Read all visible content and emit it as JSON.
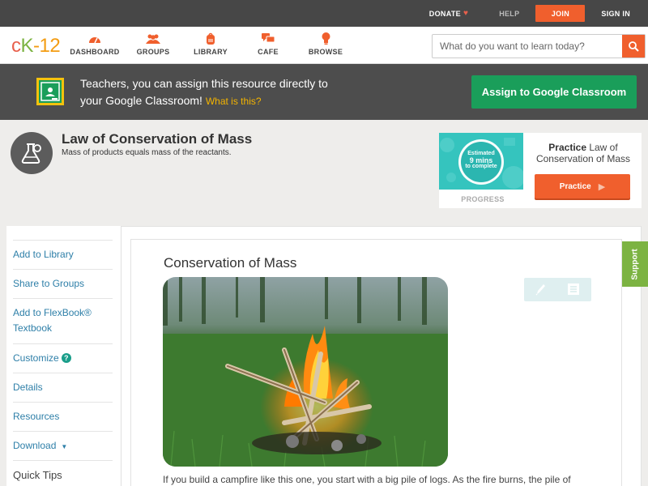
{
  "topbar": {
    "donate": "DONATE",
    "help": "HELP",
    "join": "JOIN",
    "signin": "SIGN IN"
  },
  "brand": {
    "c": "c",
    "k": "K",
    "n": "-12"
  },
  "nav": {
    "items": [
      {
        "label": "DASHBOARD",
        "icon": "gauge-icon"
      },
      {
        "label": "GROUPS",
        "icon": "people-icon"
      },
      {
        "label": "LIBRARY",
        "icon": "backpack-icon"
      },
      {
        "label": "CAFE",
        "icon": "chat-bubbles-icon"
      },
      {
        "label": "BROWSE",
        "icon": "lightbulb-icon"
      }
    ],
    "search_placeholder": "What do you want to learn today?"
  },
  "banner": {
    "line1": "Teachers, you can assign this resource directly to",
    "line2": "your Google Classroom!",
    "what": "What is this?",
    "assign_label": "Assign to Google Classroom"
  },
  "concept": {
    "title": "Law of Conservation of Mass",
    "subtitle": "Mass of products equals mass of the reactants."
  },
  "practice": {
    "estimated": "Estimated",
    "mins": "9 mins",
    "to_complete": "to complete",
    "progress_label": "PROGRESS",
    "practice_word": "Practice",
    "practice_topic": " Law of Conservation of Mass",
    "button_label": "Practice"
  },
  "sidebar": {
    "items": [
      "Add to Library",
      "Share to Groups",
      "Add to FlexBook® Textbook",
      "Customize",
      "Details",
      "Resources",
      "Download",
      "Quick Tips"
    ]
  },
  "content": {
    "heading": "Conservation of Mass",
    "body": "If you build a campfire like this one, you start with a big pile of logs. As the fire burns, the pile of"
  },
  "support": "Support",
  "colors": {
    "accent_orange": "#f05f2d",
    "google_green": "#1a9e5a",
    "link_blue": "#2e7fa8",
    "support_green": "#7cb342"
  }
}
